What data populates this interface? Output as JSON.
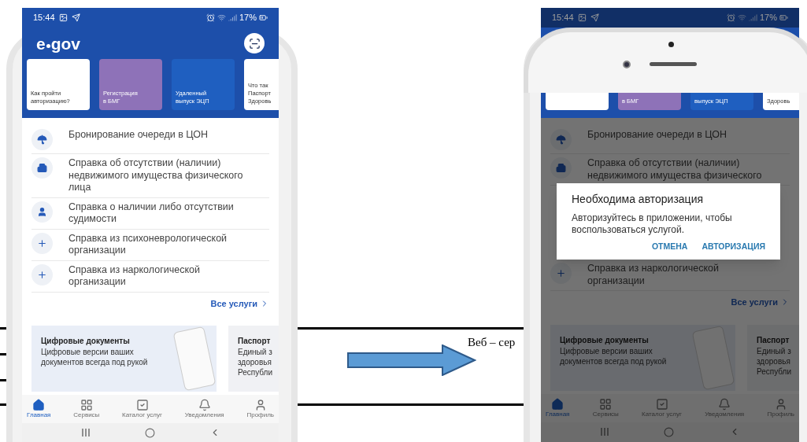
{
  "document": {
    "text": "Веб – сер"
  },
  "phones": [
    {
      "status_bar": {
        "time": "15:44",
        "battery": "17%"
      },
      "header": {
        "logo_start": "e",
        "logo_end": "gov"
      },
      "cards": [
        {
          "lines": [
            "Как пройти",
            "авторизацию?"
          ],
          "color": "#ffffff"
        },
        {
          "lines": [
            "Регистрация",
            "в БМГ"
          ],
          "color": "#8e72b8"
        },
        {
          "lines": [
            "Удаленный",
            "выпуск ЭЦП"
          ],
          "color": "#1f5fc0"
        },
        {
          "lines": [
            "Что так",
            "Паспорт",
            "Здоровь"
          ],
          "color": "#ffffff"
        }
      ],
      "services": [
        {
          "lines": [
            "Бронирование очереди в ЦОН"
          ]
        },
        {
          "lines": [
            "Справка об отсутствии (наличии)",
            "недвижимого имущества физического",
            "лица"
          ]
        },
        {
          "lines": [
            "Справка о наличии либо отсутствии",
            "судимости"
          ]
        },
        {
          "lines": [
            "Справка из психоневрологической",
            "организации"
          ]
        },
        {
          "lines": [
            "Справка из наркологической",
            "организации"
          ]
        }
      ],
      "all_services": "Все услуги",
      "banners": [
        {
          "kind": "illustrated",
          "title": "Цифровые документы",
          "lines": [
            "Цифровые версии ваших",
            "документов всегда под рукой"
          ]
        },
        {
          "kind": "plain",
          "title": "Паспорт",
          "lines": [
            "Единый з",
            "здоровья",
            "Республи"
          ]
        }
      ],
      "nav": [
        {
          "label": "Главная",
          "selected": true
        },
        {
          "label": "Сервисы",
          "selected": false
        },
        {
          "label": "Каталог услуг",
          "selected": false
        },
        {
          "label": "Уведомления",
          "selected": false
        },
        {
          "label": "Профиль",
          "selected": false
        }
      ]
    },
    {
      "status_bar": {
        "time": "15:44",
        "battery": "17%"
      },
      "cards": [
        {
          "color": "#ffffff"
        },
        {
          "lines": [
            "в БМГ"
          ],
          "color": "#8e72b8"
        },
        {
          "lines": [
            "выпуск ЭЦП"
          ],
          "color": "#1f5fc0"
        },
        {
          "lines": [
            "Здоровь"
          ],
          "color": "#ffffff"
        }
      ],
      "services": [
        {
          "lines": [
            "Бронирование очереди в ЦОН"
          ]
        },
        {
          "lines": [
            "Справка об отсутствии (наличии)",
            "недвижимого имущества физического"
          ]
        },
        {
          "lines": [
            "Справка из наркологической",
            "организации"
          ]
        }
      ],
      "all_services": "Все услуги",
      "banners": [
        {
          "kind": "illustrated",
          "title": "Цифровые документы",
          "lines": [
            "Цифровые версии ваших",
            "документов всегда под рукой"
          ]
        },
        {
          "kind": "plain",
          "title": "Паспорт",
          "lines": [
            "Единый з",
            "здоровья",
            "Республи"
          ]
        }
      ],
      "nav": [
        {
          "label": "Главная",
          "selected": true
        },
        {
          "label": "Сервисы",
          "selected": false
        },
        {
          "label": "Каталог услуг",
          "selected": false
        },
        {
          "label": "Уведомления",
          "selected": false
        },
        {
          "label": "Профиль",
          "selected": false
        }
      ],
      "dialog": {
        "title": "Необходима авторизация",
        "text": "Авторизуйтесь в приложении, чтобы воспользоваться услугой.",
        "buttons": [
          "ОТМЕНА",
          "АВТОРИЗАЦИЯ"
        ]
      }
    }
  ]
}
